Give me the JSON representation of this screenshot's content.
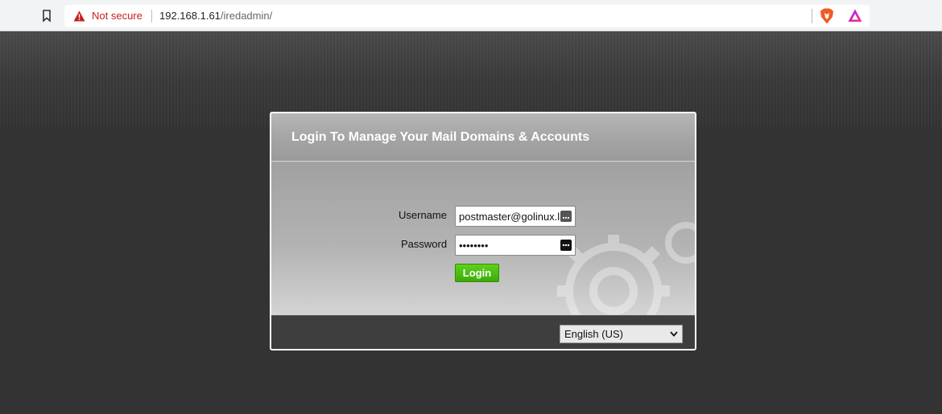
{
  "browser": {
    "security_label": "Not secure",
    "url_host": "192.168.1.61",
    "url_path": "/iredadmin/"
  },
  "login": {
    "title": "Login To Manage Your Mail Domains & Accounts",
    "username_label": "Username",
    "username_value": "postmaster@golinux.lan",
    "password_label": "Password",
    "password_value": "••••••••",
    "login_button": "Login"
  },
  "footer": {
    "language_selected": "English (US)"
  },
  "colors": {
    "login_button": "#4cc012",
    "not_secure": "#c5221f",
    "page_bg": "#333333"
  },
  "icons": [
    "bookmark-icon",
    "warning-icon",
    "brave-icon",
    "rewards-icon",
    "password-key-icon",
    "chevron-down-icon",
    "gears-icon"
  ]
}
